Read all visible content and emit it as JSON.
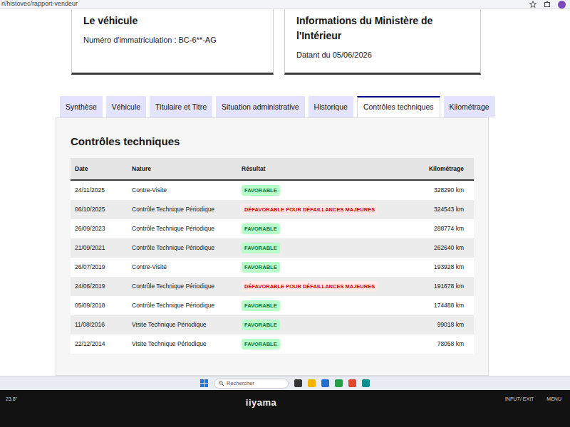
{
  "browser": {
    "url": "ri/histovec/rapport-vendeur"
  },
  "vehicle_card": {
    "title": "Le véhicule",
    "plate": "Numéro d'immatriculation : BC-6**-AG"
  },
  "ministry_card": {
    "title": "Informations du Ministère de l'Intérieur",
    "date": "Datant du 05/06/2026"
  },
  "tabs": [
    {
      "label": "Synthèse",
      "selected": false
    },
    {
      "label": "Véhicule",
      "selected": false
    },
    {
      "label": "Titulaire et Titre",
      "selected": false
    },
    {
      "label": "Situation administrative",
      "selected": false
    },
    {
      "label": "Historique",
      "selected": false
    },
    {
      "label": "Contrôles techniques",
      "selected": true
    },
    {
      "label": "Kilométrage",
      "selected": false
    }
  ],
  "section_title": "Contrôles techniques",
  "table": {
    "columns": [
      "Date",
      "Nature",
      "Résultat",
      "Kilométrage"
    ],
    "rows": [
      {
        "date": "24/11/2025",
        "nature": "Contre-Visite",
        "result": "FAVORABLE",
        "kind": "favorable",
        "km": "328290 km"
      },
      {
        "date": "06/10/2025",
        "nature": "Contrôle Technique Périodique",
        "result": "DÉFAVORABLE POUR DÉFAILLANCES MAJEURES",
        "kind": "defavorable",
        "km": "324543 km"
      },
      {
        "date": "26/09/2023",
        "nature": "Contrôle Technique Périodique",
        "result": "FAVORABLE",
        "kind": "favorable",
        "km": "288774 km"
      },
      {
        "date": "21/09/2021",
        "nature": "Contrôle Technique Périodique",
        "result": "FAVORABLE",
        "kind": "favorable",
        "km": "262640 km"
      },
      {
        "date": "26/07/2019",
        "nature": "Contre-Visite",
        "result": "FAVORABLE",
        "kind": "favorable",
        "km": "193928 km"
      },
      {
        "date": "24/06/2019",
        "nature": "Contrôle Technique Périodique",
        "result": "DÉFAVORABLE POUR DÉFAILLANCES MAJEURES",
        "kind": "defavorable",
        "km": "191678 km"
      },
      {
        "date": "05/09/2018",
        "nature": "Contrôle Technique Périodique",
        "result": "FAVORABLE",
        "kind": "favorable",
        "km": "174488 km"
      },
      {
        "date": "11/08/2016",
        "nature": "Visite Technique Périodique",
        "result": "FAVORABLE",
        "kind": "favorable",
        "km": "99018 km"
      },
      {
        "date": "22/12/2014",
        "nature": "Visite Technique Périodique",
        "result": "FAVORABLE",
        "kind": "favorable",
        "km": "78058 km"
      }
    ]
  },
  "taskbar": {
    "search": "Rechercher"
  },
  "monitor": {
    "size": "23.8\"",
    "brand": "iiyama",
    "buttons": [
      "INPUT/ EXIT",
      "MENU"
    ]
  }
}
